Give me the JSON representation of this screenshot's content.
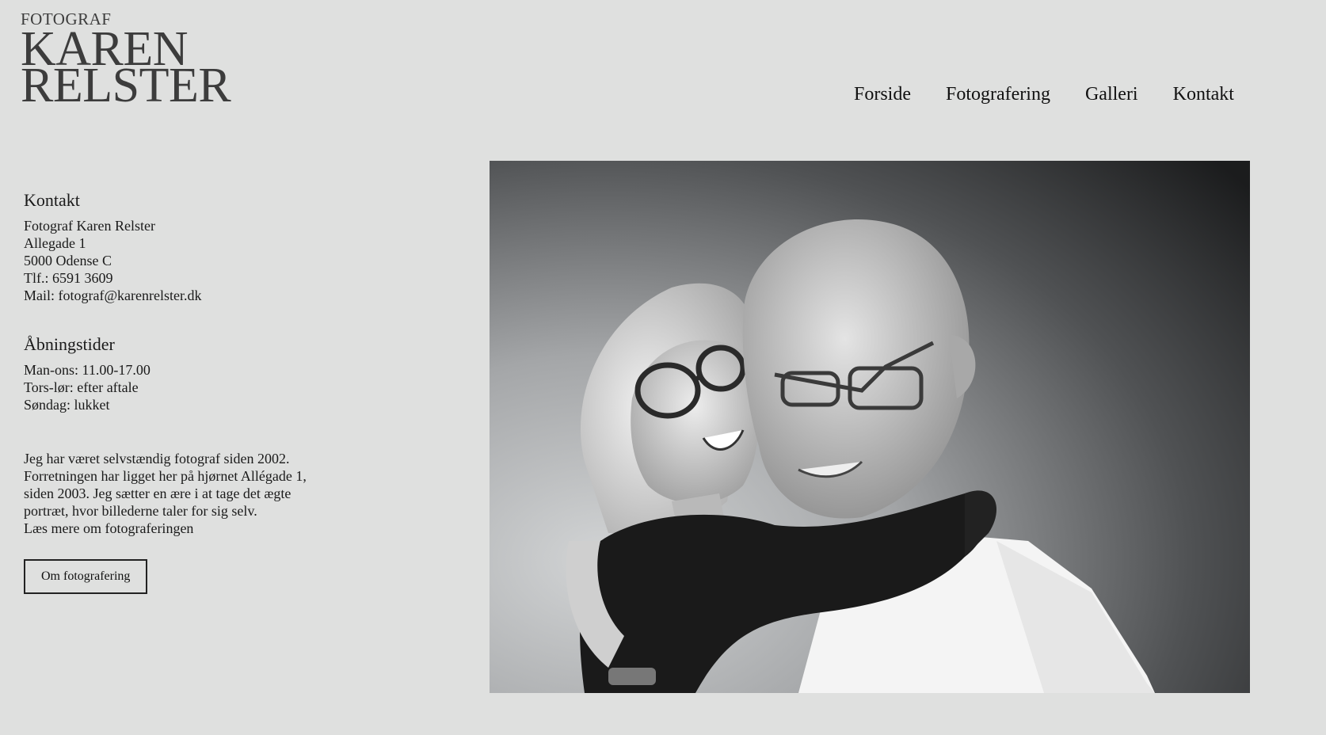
{
  "logo": {
    "line1": "FOTOGRAF",
    "line2": "KAREN",
    "line3": "RELSTER"
  },
  "nav": {
    "items": [
      {
        "label": "Forside"
      },
      {
        "label": "Fotografering"
      },
      {
        "label": "Galleri"
      },
      {
        "label": "Kontakt"
      }
    ]
  },
  "contact": {
    "heading": "Kontakt",
    "name": "Fotograf Karen Relster",
    "street": "Allegade 1",
    "city": "5000 Odense C",
    "phone": "Tlf.: 6591 3609",
    "mail": "Mail: fotograf@karenrelster.dk"
  },
  "hours": {
    "heading": "Åbningstider",
    "lines": [
      "Man-ons: 11.00-17.00",
      "Tors-lør: efter aftale",
      "Søndag: lukket"
    ]
  },
  "about": {
    "line1": "Jeg har været selvstændig fotograf siden 2002.",
    "line2": "Forretningen har ligget her på hjørnet Allégade 1,",
    "line3": "siden 2003. Jeg sætter en ære i at tage det ægte",
    "line4": "portræt, hvor billederne taler for sig selv.",
    "read_more": "Læs mere om fotograferingen",
    "button_label": "Om fotografering"
  },
  "photo": {
    "icon": "portrait-photo-couple-embracing"
  }
}
